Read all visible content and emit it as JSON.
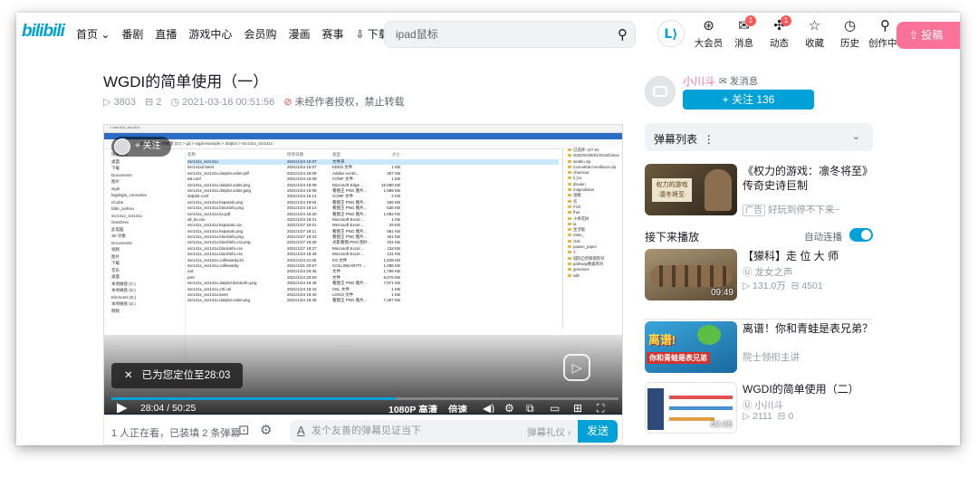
{
  "header": {
    "logo": "bilibili",
    "nav": [
      "首页 ⌄",
      "番剧",
      "直播",
      "游戏中心",
      "会员购",
      "漫画",
      "赛事",
      "下载客户端"
    ],
    "search_placeholder": "ipad鼠标",
    "icons": [
      {
        "icon": "vip-icon",
        "label": "大会员",
        "badge": ""
      },
      {
        "icon": "message-icon",
        "label": "消息",
        "badge": "1"
      },
      {
        "icon": "dynamic-icon",
        "label": "动态",
        "badge": "1"
      },
      {
        "icon": "star-icon",
        "label": "收藏",
        "badge": ""
      },
      {
        "icon": "clock-icon",
        "label": "历史",
        "badge": ""
      },
      {
        "icon": "bulb-icon",
        "label": "创作中心",
        "badge": ""
      }
    ],
    "upload": "投稿",
    "avatar_text": "ᒪ⟩"
  },
  "video": {
    "title": "WGDI的简单使用（一）",
    "views": "3803",
    "danmaku_count": "2",
    "date": "2021-03-16 00:51:56",
    "copyright": "未经作者授权，禁止转载"
  },
  "player": {
    "follow_label": "+ 关注",
    "toast": "已为您定位至28:03",
    "time": "28:04 / 50:25",
    "quality": "1080P 高清",
    "speed": "倍速",
    "progress": 0.56,
    "accent": "#00a1d6",
    "explorer": {
      "title": "> ssr141x_ssr141x",
      "address": "此电脑 > 本地磁盘 (D:) > gd > wgdi-example > dotplot > ssr141x_ssr141x",
      "sidebar": [
        "快速访问",
        "桌面",
        "下载",
        "Documents",
        "图片",
        "wgdi",
        "bigdegla_consortes",
        "eCube",
        "fdde_sinfera",
        "ssr141x_ssr141x",
        "OneDrive",
        "此电脑",
        "3D 对象",
        "Documents",
        "视频",
        "图片",
        "下载",
        "音乐",
        "桌面",
        "本地磁盘 (C:)",
        "本地磁盘 (D:)",
        "Elements (E:)",
        "本地磁盘 (D:)",
        "网络"
      ],
      "columns": [
        "名称",
        "修改日期",
        "类型",
        "大小"
      ],
      "files": [
        [
          "ssr141x_ssr141x",
          "2021/1/24 15:07",
          "文件夹",
          ""
        ],
        [
          "ssr141x2.kees",
          "2021/1/24 15:07",
          "KEES 文件",
          "1 KB"
        ],
        [
          "ssr141x_ssr141x.dotplot.order.pdf",
          "2021/1/24 15:09",
          "Adobe Acrob...",
          "307 KB"
        ],
        [
          "a8.conf",
          "2021/1/24 15:09",
          "CONF 文件",
          "1 KB"
        ],
        [
          "ssr141x_ssr141x.dotplot.order.png",
          "2021/1/24 15:09",
          "Microsoft Edge ...",
          "16,960 KB"
        ],
        [
          "ssr141x_ssr141x.dotplot.order.jpeg",
          "2021/1/24 15:09",
          "看图王 PNG 图片...",
          "1,685 KB"
        ],
        [
          "dotplot.conf",
          "2021/1/24 15:14",
          "CONF 文件",
          "2 KB"
        ],
        [
          "ssr141x_ssr141x.ksparalo.png",
          "2021/1/24 19:04",
          "看图王 PNG 图片...",
          "155 KB"
        ],
        [
          "ssr141x_ssr141x.blockinfo.png",
          "2021/1/24 19:14",
          "看图王 PNG 图片...",
          "536 KB"
        ],
        [
          "ssr141x_ssr141x.ks.pdf",
          "2021/1/24 19:20",
          "看图王 PNG 图片...",
          "1,082 KB"
        ],
        [
          "all_ks.csv",
          "2021/1/24 19:21",
          "Microsoft Excel ...",
          "1 KB"
        ],
        [
          "ssr141x_ssr141x.ksparalo.csv",
          "2021/1/27 20:01",
          "Microsoft Excel ...",
          "29 KB"
        ],
        [
          "ssr141x_ssr141x.ksparalo.png",
          "2021/1/27 18:11",
          "看图王 PNG 图片...",
          "581 KB"
        ],
        [
          "ssr141x_ssr141x.blockinfo.png",
          "2021/1/27 18:23",
          "看图王 PNG 图片...",
          "461 KB"
        ],
        [
          "ssr141x_ssr141x.blockinfo.csv.png",
          "2021/1/27 18:28",
          "光影看图 PNG 图片...",
          "331 KB"
        ],
        [
          "ssr141x_ssr141x.blockinfo.csv",
          "2021/1/27 18:27",
          "Microsoft Excel ...",
          "118 KB"
        ],
        [
          "ssr141x_ssr141x.blockinfo.csv",
          "2021/1/24 18:49",
          "Microsoft Excel ...",
          "131 KB"
        ],
        [
          "ssr141x_ssr141x.collinearity.ks",
          "2021/1/24 21:05",
          "KS 文件",
          "1,538 KB"
        ],
        [
          "ssr141x_ssr141x.collinearity",
          "2021/1/21 20:57",
          "COLLINEARITY ...",
          "1,085 KB"
        ],
        [
          "out",
          "2021/1/24 20:45",
          "文件",
          "1,766 KB"
        ],
        [
          "prer",
          "2021/1/24 20:53",
          "文件",
          "9,675 KB"
        ],
        [
          "ssr141x_ssr141x.dotplot.blockinfo.png",
          "2021/1/24 19:45",
          "看图王 PNG 图片...",
          "7,571 KB"
        ],
        [
          "ssr141x_ssr141x.ctrl.cel",
          "2021/1/24 19:43",
          "CEL 文件",
          "1 KB"
        ],
        [
          "ssr141x_ssr141x.kees",
          "2021/1/24 19:40",
          "LOGO 文件",
          "1 KB"
        ],
        [
          "ssr141x_ssr141x.dotplot.order.png",
          "2021/1/24 19:36",
          "看图王 PNG 图片...",
          "7,407 KB"
        ]
      ],
      "right_panel": [
        "已选择: 427.91",
        "2020/02/08/04/2024/bxkva",
        "wrabin.zip",
        "Cuscultda.mondluera.zip",
        "chamsua",
        "li_bo",
        "jbsulen",
        "magnoliates",
        "道教",
        "名",
        "Fish",
        "fhar",
        "十季花树",
        "la",
        "生活版",
        "ratan_",
        "ctsk",
        "pawee_paper",
        "Y",
        "城际自然和图库目",
        "pathway数据库目",
        "genomes",
        "sdb"
      ]
    }
  },
  "danmaku_bar": {
    "viewers": "1 人正在看，已装填 2 条弹幕",
    "placeholder": "发个友善的弹幕见证当下",
    "etiquette": "弹幕礼仪 ›",
    "send": "发送"
  },
  "uploader": {
    "name": "小川斗",
    "message": "发消息",
    "follow": "+ 关注 136"
  },
  "danmaku_list": {
    "label": "弹幕列表",
    "dots": "⋮"
  },
  "recommend_ad": {
    "title": "《权力的游戏：凛冬将至》传奇史诗巨制",
    "tag": "广告",
    "desc": "好玩到停不下来~",
    "thumb_text": "权力的游戏\n·凛冬将至·"
  },
  "next_up": {
    "label": "接下来播放",
    "autoplay": "自动连播"
  },
  "videos": [
    {
      "title": "【獴科】走 位 大 师",
      "up": "龙女之声",
      "views": "131.0万",
      "danmaku": "4501",
      "duration": "09:49"
    },
    {
      "title": "离谱！你和青蛙是表兄弟？",
      "up": "院士领衔主讲",
      "views": "",
      "danmaku": "",
      "duration": "",
      "thumb_text1": "离谱!",
      "thumb_text2": "你和青蛙是表兄弟"
    },
    {
      "title": "WGDI的简单使用（二）",
      "up": "小川斗",
      "views": "2111",
      "danmaku": "0",
      "duration": "40:05"
    }
  ]
}
